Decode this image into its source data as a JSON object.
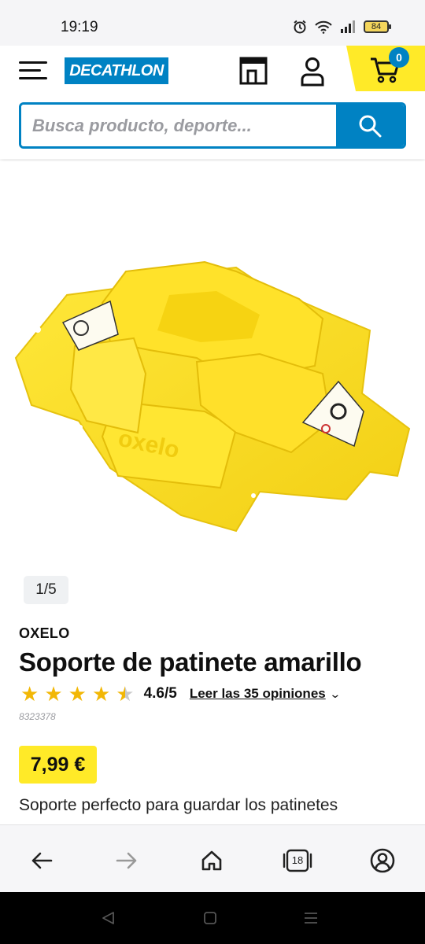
{
  "status_bar": {
    "time": "19:19",
    "battery": "84",
    "icons": [
      "alarm-icon",
      "wifi-icon",
      "signal-icon",
      "battery-icon"
    ]
  },
  "header": {
    "logo_text": "DECATHLON",
    "cart_count": "0",
    "search_placeholder": "Busca producto, deporte...",
    "colors": {
      "brand_blue": "#0082c3",
      "brand_yellow": "#ffea28"
    }
  },
  "product": {
    "image_counter": "1/5",
    "brand": "OXELO",
    "title": "Soporte de patinete amarillo",
    "rating_value": "4.6/5",
    "rating_stars": 4.5,
    "reviews_link": "Leer las 35 opiniones",
    "sku": "8323378",
    "price": "7,99 €",
    "description": "Soporte perfecto para guardar los patinetes",
    "image_text": "oxelo"
  },
  "browser_nav": {
    "tab_count": "18",
    "items": [
      "back-icon",
      "forward-icon",
      "home-icon",
      "tabs-icon",
      "account-icon"
    ]
  }
}
